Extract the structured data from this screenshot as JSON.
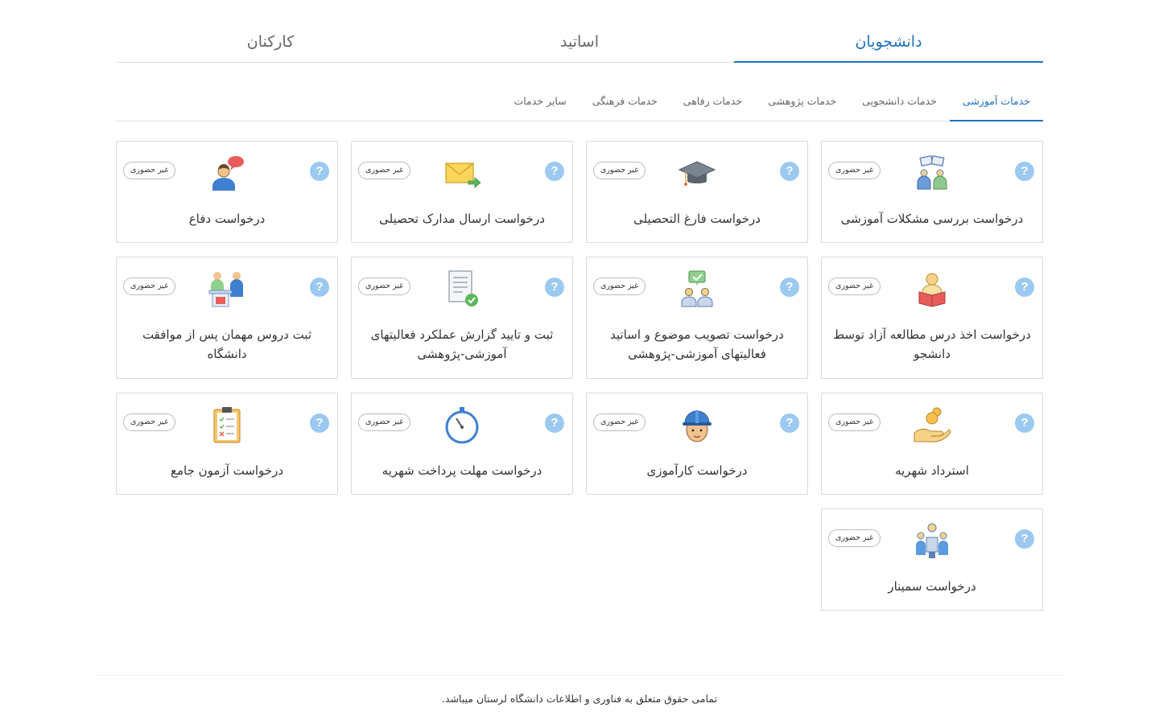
{
  "main_tabs": [
    {
      "label": "دانشجویان",
      "active": true
    },
    {
      "label": "اساتید",
      "active": false
    },
    {
      "label": "کارکنان",
      "active": false
    }
  ],
  "sub_tabs": [
    {
      "label": "خدمات آموزشی",
      "active": true
    },
    {
      "label": "خدمات دانشجویی",
      "active": false
    },
    {
      "label": "خدمات پژوهشی",
      "active": false
    },
    {
      "label": "خدمات رفاهی",
      "active": false
    },
    {
      "label": "خدمات فرهنگی",
      "active": false
    },
    {
      "label": "سایر خدمات",
      "active": false
    }
  ],
  "cards": [
    {
      "title": "درخواست بررسی مشکلات آموزشی",
      "badge": "غیر حضوری",
      "help": "?",
      "icon": "people-papers-icon"
    },
    {
      "title": "درخواست فارغ التحصیلی",
      "badge": "غیر حضوری",
      "help": "?",
      "icon": "graduation-cap-icon"
    },
    {
      "title": "درخواست ارسال مدارک تحصیلی",
      "badge": "غیر حضوری",
      "help": "?",
      "icon": "envelope-arrow-icon"
    },
    {
      "title": "درخواست دفاع",
      "badge": "غیر حضوری",
      "help": "?",
      "icon": "person-speech-icon"
    },
    {
      "title": "درخواست اخذ درس مطالعه آزاد توسط دانشجو",
      "badge": "غیر حضوری",
      "help": "?",
      "icon": "person-book-icon"
    },
    {
      "title": "درخواست تصویب موضوع و اساتید فعالیتهای آموزشی-پژوهشی",
      "badge": "غیر حضوری",
      "help": "?",
      "icon": "people-approve-icon"
    },
    {
      "title": "ثبت و تایید گزارش عملکرد فعالیتهای آموزشی-پژوهشی",
      "badge": "غیر حضوری",
      "help": "?",
      "icon": "report-check-icon"
    },
    {
      "title": "ثبت دروس مهمان پس از موافقت دانشگاه",
      "badge": "غیر حضوری",
      "help": "?",
      "icon": "guest-desk-icon"
    },
    {
      "title": "استرداد شهریه",
      "badge": "غیر حضوری",
      "help": "?",
      "icon": "hand-coin-icon"
    },
    {
      "title": "درخواست کارآموزی",
      "badge": "غیر حضوری",
      "help": "?",
      "icon": "worker-helmet-icon"
    },
    {
      "title": "درخواست مهلت پرداخت شهریه",
      "badge": "غیر حضوری",
      "help": "?",
      "icon": "stopwatch-icon"
    },
    {
      "title": "درخواست آزمون جامع",
      "badge": "غیر حضوری",
      "help": "?",
      "icon": "clipboard-exam-icon"
    },
    {
      "title": "درخواست سمینار",
      "badge": "غیر حضوری",
      "help": "?",
      "icon": "seminar-meeting-icon"
    }
  ],
  "footer": {
    "text": "تمامی حقوق متعلق به فناوری و اطلاعات دانشگاه لرستان میباشد."
  }
}
